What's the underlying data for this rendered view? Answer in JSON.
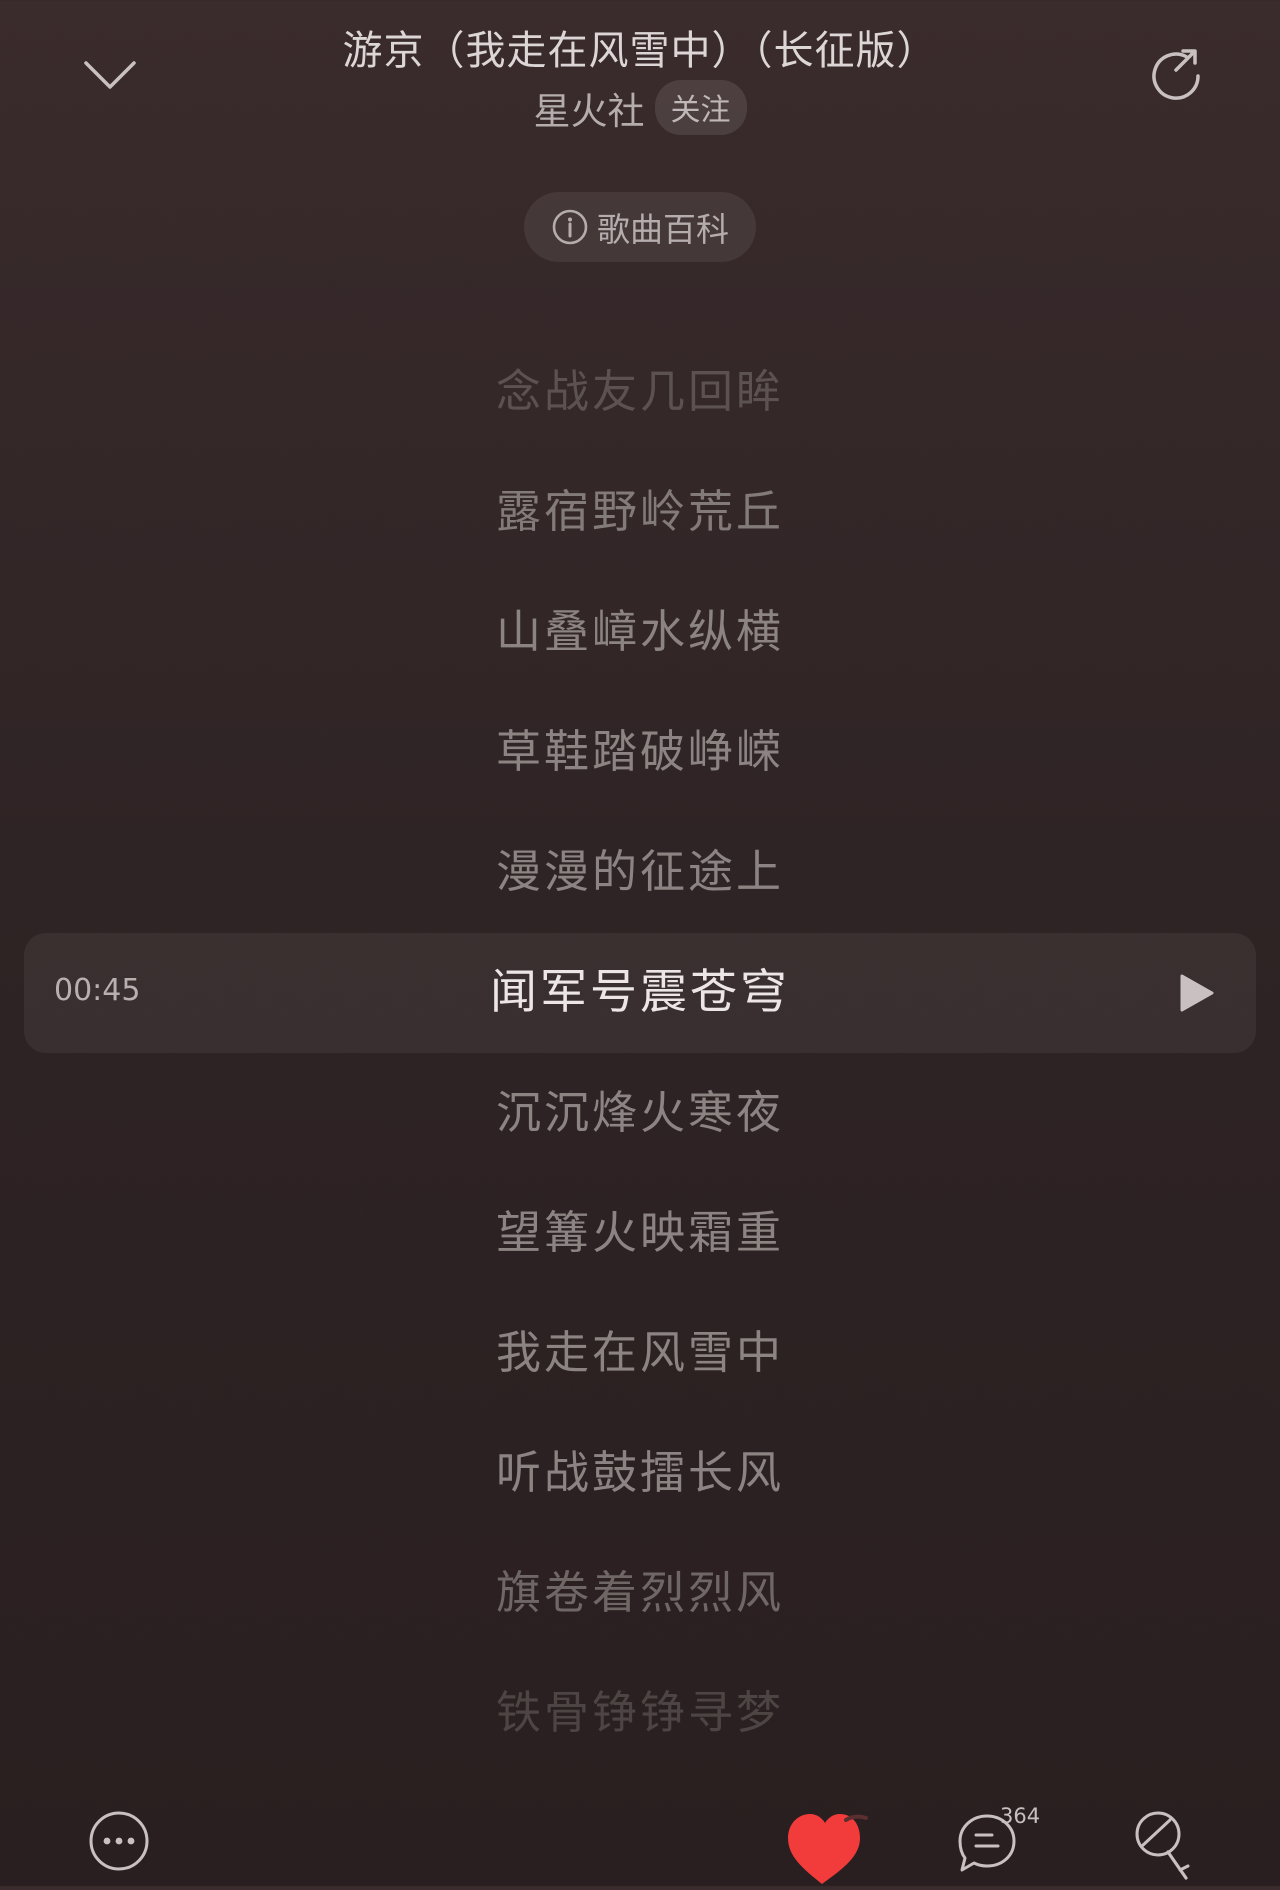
{
  "header": {
    "collapse_icon": "chevron-down-icon",
    "share_icon": "share-icon",
    "title": "游京（我走在风雪中）（长征版）",
    "artist": "星火社",
    "follow_label": "关注"
  },
  "wiki": {
    "icon": "info-icon",
    "label": "歌曲百科"
  },
  "lyrics": {
    "lines": [
      "念战友几回眸",
      "露宿野岭荒丘",
      "山叠嶂水纵横",
      "草鞋踏破峥嵘",
      "漫漫的征途上",
      "闻军号震苍穹",
      "沉沉烽火寒夜",
      "望篝火映霜重",
      "我走在风雪中",
      "听战鼓擂长风",
      "旗卷着烈烈风",
      "铁骨铮铮寻梦"
    ],
    "current_index": 5,
    "current_time": "00:45",
    "play_icon": "play-icon"
  },
  "bottom": {
    "more_icon": "more-icon",
    "like_icon": "heart-icon",
    "like_color": "#f23b3b",
    "comment_icon": "comment-icon",
    "comment_count": "364",
    "mic_icon": "microphone-icon"
  }
}
